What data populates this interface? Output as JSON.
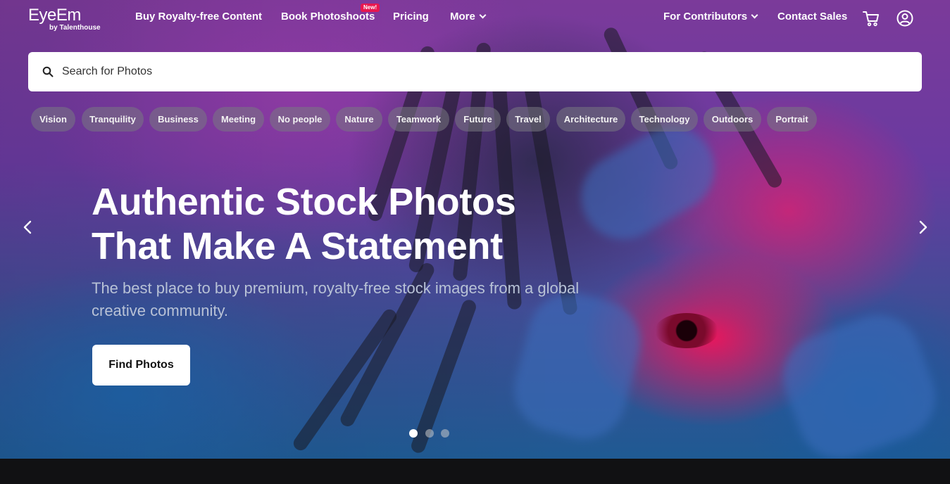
{
  "brand": {
    "name": "EyeEm",
    "byline": "by Talenthouse"
  },
  "nav": {
    "buy": "Buy Royalty-free Content",
    "book": "Book Photoshoots",
    "book_badge": "New!",
    "pricing": "Pricing",
    "more": "More",
    "contributors": "For Contributors",
    "contact": "Contact Sales",
    "cart_icon": "cart-icon",
    "account_icon": "user-circle-icon"
  },
  "search": {
    "placeholder": "Search for Photos",
    "icon": "search-icon"
  },
  "tags": [
    "Vision",
    "Tranquility",
    "Business",
    "Meeting",
    "No people",
    "Nature",
    "Teamwork",
    "Future",
    "Travel",
    "Architecture",
    "Technology",
    "Outdoors",
    "Portrait"
  ],
  "hero": {
    "title_line1": "Authentic Stock Photos",
    "title_line2": "That Make A Statement",
    "subtitle": "The best place to buy premium, royalty-free stock images from a global creative community.",
    "cta": "Find Photos",
    "prev_icon": "chevron-left-icon",
    "next_icon": "chevron-right-icon"
  },
  "carousel": {
    "slide_count": 3,
    "active_index": 0
  },
  "colors": {
    "badge": "#e8174f",
    "button_bg": "#ffffff",
    "subtitle": "#b8c2d6"
  }
}
